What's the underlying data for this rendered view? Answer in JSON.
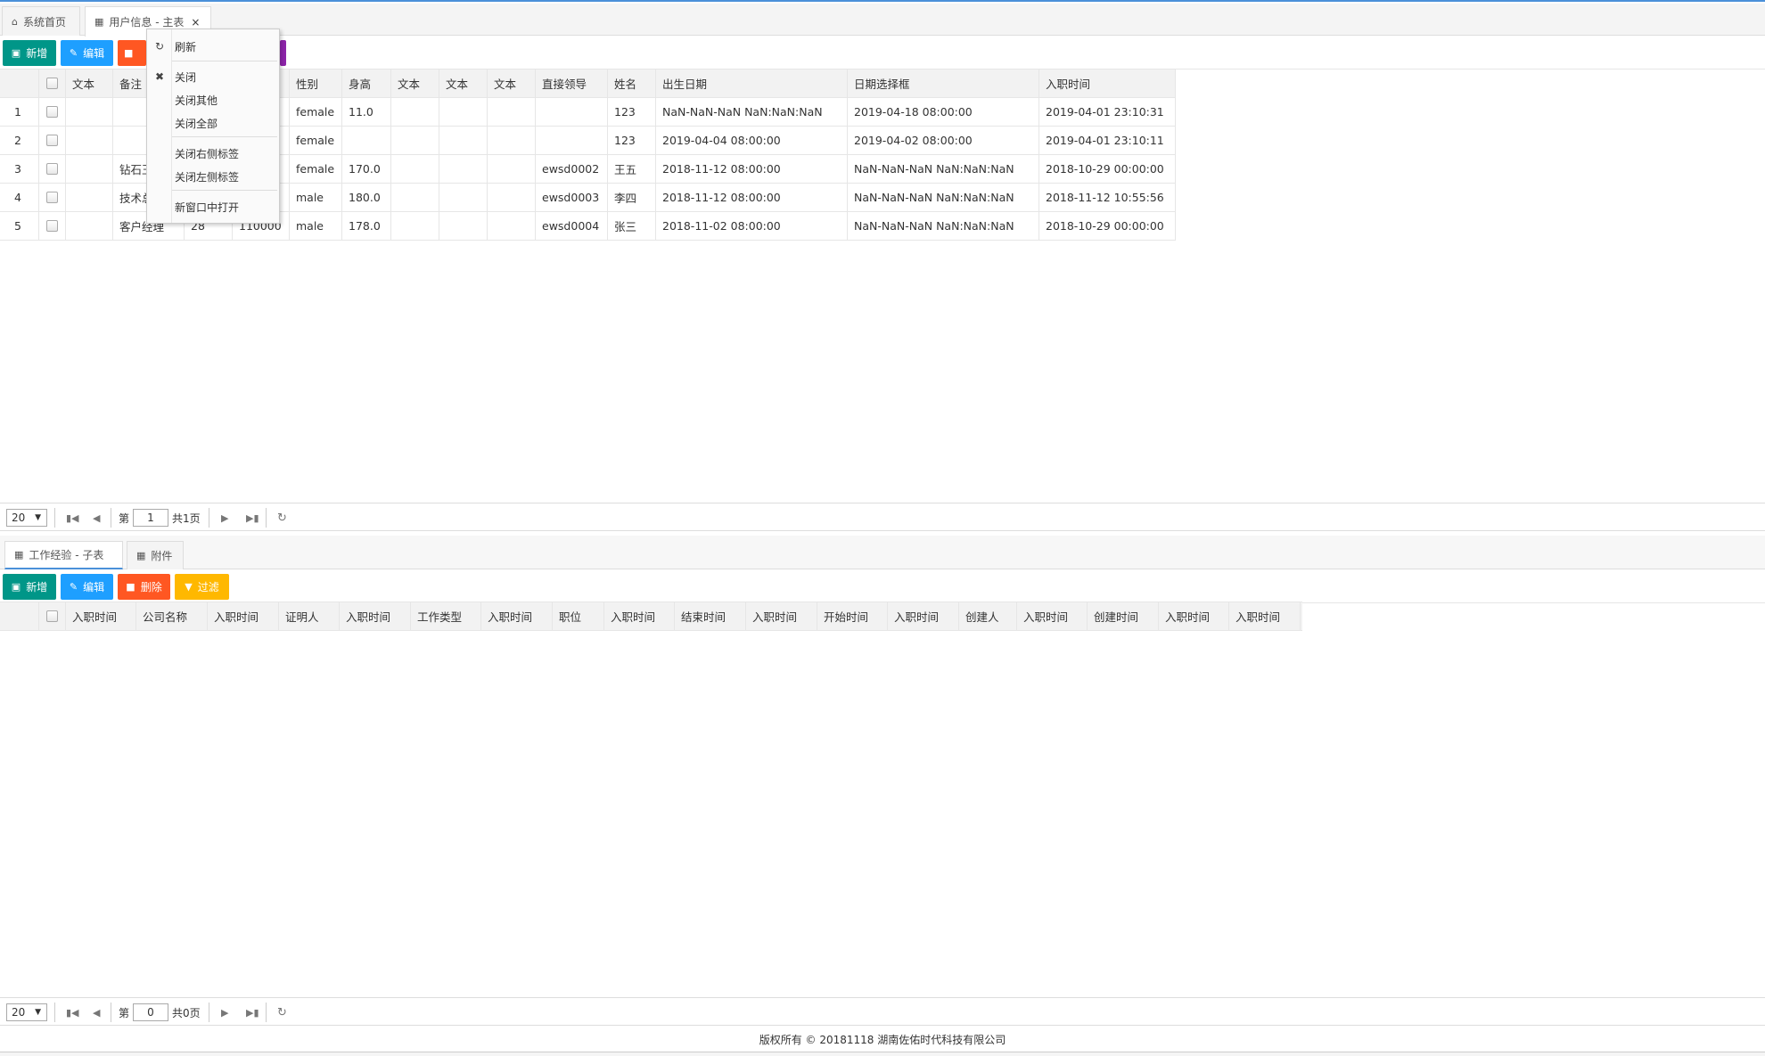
{
  "top_tabs": [
    {
      "label": "系统首页",
      "icon": "home-icon"
    },
    {
      "label": "用户信息 - 主表",
      "icon": "grid-icon",
      "close": "×"
    }
  ],
  "main_toolbar": {
    "add": "新增",
    "edit": "编辑"
  },
  "context_menu": {
    "refresh": "刷新",
    "close": "关闭",
    "close_others": "关闭其他",
    "close_all": "关闭全部",
    "close_right": "关闭右侧标签",
    "close_left": "关闭左侧标签",
    "open_new_window": "新窗口中打开"
  },
  "main_grid": {
    "columns": [
      "文本",
      "备注",
      "",
      "",
      "性别",
      "身高",
      "文本",
      "文本",
      "文本",
      "直接领导",
      "姓名",
      "出生日期",
      "日期选择框",
      "入职时间"
    ],
    "rows": [
      {
        "no": "1",
        "c1": "",
        "c2": "",
        "c3": "",
        "c4": "",
        "gender": "female",
        "height": "11.0",
        "t1": "",
        "t2": "",
        "t3": "",
        "leader": "",
        "name": "123",
        "birth": "NaN-NaN-NaN NaN:NaN:NaN",
        "date": "2019-04-18 08:00:00",
        "join": "2019-04-01 23:10:31"
      },
      {
        "no": "2",
        "c1": "",
        "c2": "",
        "c3": "",
        "c4": "",
        "gender": "female",
        "height": "",
        "t1": "",
        "t2": "",
        "t3": "",
        "leader": "",
        "name": "123",
        "birth": "2019-04-04 08:00:00",
        "date": "2019-04-02 08:00:00",
        "join": "2019-04-01 23:10:11"
      },
      {
        "no": "3",
        "c1": "",
        "c2": "钻石王",
        "c3": "",
        "c4": "",
        "gender": "female",
        "height": "170.0",
        "t1": "",
        "t2": "",
        "t3": "",
        "leader": "ewsd0002",
        "name": "王五",
        "birth": "2018-11-12 08:00:00",
        "date": "NaN-NaN-NaN NaN:NaN:NaN",
        "join": "2018-10-29 00:00:00"
      },
      {
        "no": "4",
        "c1": "",
        "c2": "技术总",
        "c3": "",
        "c4": "",
        "gender": "male",
        "height": "180.0",
        "t1": "",
        "t2": "",
        "t3": "",
        "leader": "ewsd0003",
        "name": "李四",
        "birth": "2018-11-12 08:00:00",
        "date": "NaN-NaN-NaN NaN:NaN:NaN",
        "join": "2018-11-12 10:55:56"
      },
      {
        "no": "5",
        "c1": "",
        "c2": "客户经理",
        "c3": "28",
        "c4": "110000",
        "gender": "male",
        "height": "178.0",
        "t1": "",
        "t2": "",
        "t3": "",
        "leader": "ewsd0004",
        "name": "张三",
        "birth": "2018-11-02 08:00:00",
        "date": "NaN-NaN-NaN NaN:NaN:NaN",
        "join": "2018-10-29 00:00:00"
      }
    ]
  },
  "main_pager": {
    "page_size": "20",
    "page_prefix": "第",
    "page_value": "1",
    "page_suffix": "共1页"
  },
  "sub_tabs": [
    {
      "label": "工作经验 - 子表",
      "icon": "grid-icon"
    },
    {
      "label": "附件",
      "icon": "grid-icon"
    }
  ],
  "sub_toolbar": {
    "add": "新增",
    "edit": "编辑",
    "delete": "删除",
    "filter": "过滤"
  },
  "sub_grid": {
    "columns": [
      "入职时间",
      "公司名称",
      "入职时间",
      "证明人",
      "入职时间",
      "工作类型",
      "入职时间",
      "职位",
      "入职时间",
      "结束时间",
      "入职时间",
      "开始时间",
      "入职时间",
      "创建人",
      "入职时间",
      "创建时间",
      "入职时间",
      "入职时间"
    ]
  },
  "sub_pager": {
    "page_size": "20",
    "page_prefix": "第",
    "page_value": "0",
    "page_suffix": "共0页"
  },
  "footer": {
    "text": "版权所有 © 20181118 湖南佐佑时代科技有限公司"
  },
  "colors": {
    "green": "#009688",
    "blue": "#1e9fff",
    "red": "#ff5722",
    "orange": "#ffb800",
    "purple": "#8e24aa",
    "accent": "#4a90d9"
  }
}
